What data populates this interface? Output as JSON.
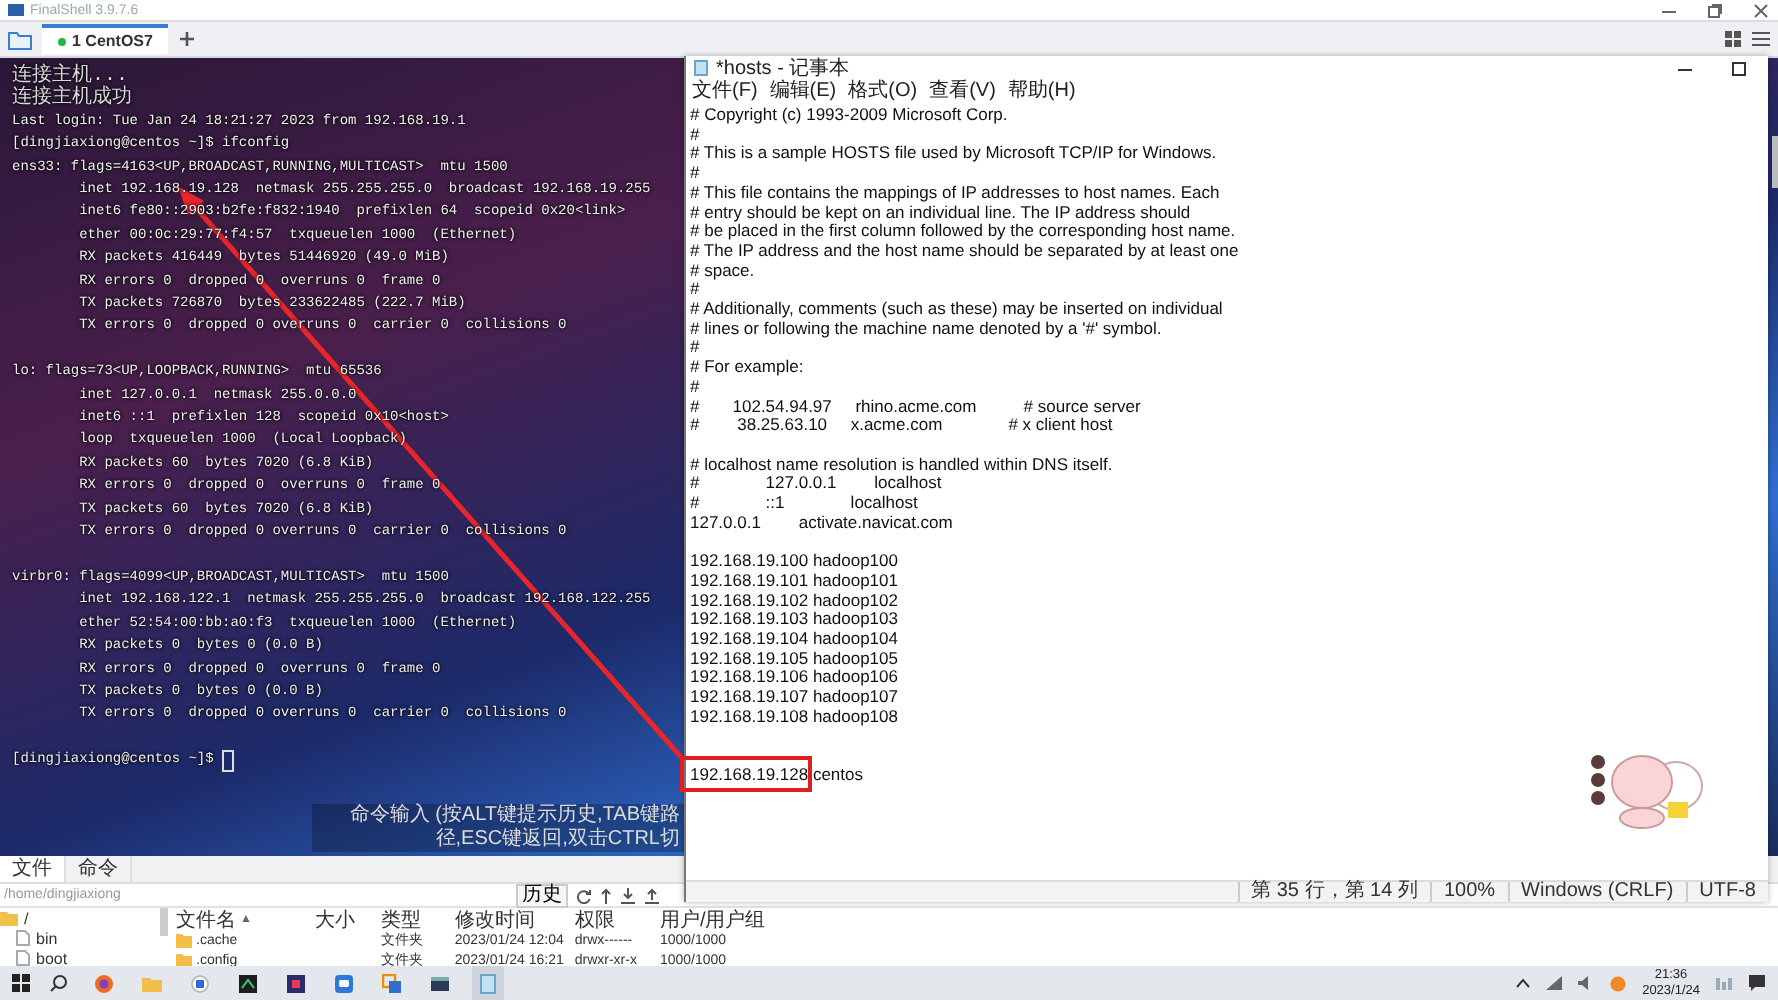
{
  "finalshell": {
    "title": "FinalShell 3.9.7.6",
    "tabs": [
      {
        "label": "1 CentOS7",
        "selected": true
      }
    ]
  },
  "terminal": {
    "messages": [
      "连接主机...",
      "连接主机成功"
    ],
    "blocks": [
      [
        "Last login: Tue Jan 24 18:21:27 2023 from 192.168.19.1",
        "[dingjiaxiong@centos ~]$ ifconfig",
        "ens33: flags=4163<UP,BROADCAST,RUNNING,MULTICAST>  mtu 1500",
        "        inet 192.168.19.128  netmask 255.255.255.0  broadcast 192.168.19.255",
        "        inet6 fe80::2903:b2fe:f832:1940  prefixlen 64  scopeid 0x20<link>",
        "        ether 00:0c:29:77:f4:57  txqueuelen 1000  (Ethernet)",
        "        RX packets 416449  bytes 51446920 (49.0 MiB)",
        "        RX errors 0  dropped 0  overruns 0  frame 0",
        "        TX packets 726870  bytes 233622485 (222.7 MiB)",
        "        TX errors 0  dropped 0 overruns 0  carrier 0  collisions 0"
      ],
      [
        "lo: flags=73<UP,LOOPBACK,RUNNING>  mtu 65536",
        "        inet 127.0.0.1  netmask 255.0.0.0",
        "        inet6 ::1  prefixlen 128  scopeid 0x10<host>",
        "        loop  txqueuelen 1000  (Local Loopback)",
        "        RX packets 60  bytes 7020 (6.8 KiB)",
        "        RX errors 0  dropped 0  overruns 0  frame 0",
        "        TX packets 60  bytes 7020 (6.8 KiB)",
        "        TX errors 0  dropped 0 overruns 0  carrier 0  collisions 0"
      ],
      [
        "virbr0: flags=4099<UP,BROADCAST,MULTICAST>  mtu 1500",
        "        inet 192.168.122.1  netmask 255.255.255.0  broadcast 192.168.122.255",
        "        ether 52:54:00:bb:a0:f3  txqueuelen 1000  (Ethernet)",
        "        RX packets 0  bytes 0 (0.0 B)",
        "        RX errors 0  dropped 0  overruns 0  frame 0",
        "        TX packets 0  bytes 0 (0.0 B)",
        "        TX errors 0  dropped 0 overruns 0  carrier 0  collisions 0"
      ]
    ],
    "prompt": "[dingjiaxiong@centos ~]$",
    "hint": "命令输入 (按ALT键提示历史,TAB键路径,ESC键返回,双击CTRL切"
  },
  "file_panel": {
    "tabs": [
      {
        "label": "文件",
        "selected": true
      },
      {
        "label": "命令",
        "selected": false
      }
    ],
    "path": "/home/dingjiaxiong",
    "history_button": "历史",
    "tree": [
      {
        "label": "/",
        "kind": "folder",
        "children": [
          {
            "label": "bin",
            "kind": "link"
          },
          {
            "label": "boot",
            "kind": "link"
          }
        ]
      }
    ],
    "table": {
      "columns": [
        {
          "label": "文件名",
          "sort_indicator": "▲"
        },
        {
          "label": "大小"
        },
        {
          "label": "类型"
        },
        {
          "label": "修改时间"
        },
        {
          "label": "权限"
        },
        {
          "label": "用户/用户组"
        }
      ],
      "rows": [
        {
          "name": ".cache",
          "type": "文件夹",
          "modified": "2023/01/24 12:04",
          "permissions": "drwx------",
          "owner": "1000/1000"
        },
        {
          "name": ".config",
          "type": "文件夹",
          "modified": "2023/01/24 16:21",
          "permissions": "drwxr-xr-x",
          "owner": "1000/1000"
        }
      ]
    }
  },
  "notepad": {
    "title": "*hosts - 记事本",
    "menu": [
      "文件(F)",
      "编辑(E)",
      "格式(O)",
      "查看(V)",
      "帮助(H)"
    ],
    "text": "# Copyright (c) 1993-2009 Microsoft Corp.\n#\n# This is a sample HOSTS file used by Microsoft TCP/IP for Windows.\n#\n# This file contains the mappings of IP addresses to host names. Each\n# entry should be kept on an individual line. The IP address should\n# be placed in the first column followed by the corresponding host name.\n# The IP address and the host name should be separated by at least one\n# space.\n#\n# Additionally, comments (such as these) may be inserted on individual\n# lines or following the machine name denoted by a '#' symbol.\n#\n# For example:\n#\n#       102.54.94.97     rhino.acme.com          # source server\n#        38.25.63.10     x.acme.com              # x client host\n\n# localhost name resolution is handled within DNS itself.\n#              127.0.0.1        localhost\n#              ::1              localhost\n127.0.0.1        activate.navicat.com\n\n192.168.19.100 hadoop100\n192.168.19.101 hadoop101\n192.168.19.102 hadoop102\n192.168.19.103 hadoop103\n192.168.19.104 hadoop104\n192.168.19.105 hadoop105\n192.168.19.106 hadoop106\n192.168.19.107 hadoop107\n192.168.19.108 hadoop108\n\n\n192.168.19.128 centos",
    "status": [
      "第 35 行，第 14 列",
      "100%",
      "Windows (CRLF)",
      "UTF-8"
    ]
  },
  "taskbar": {
    "time": "21:36",
    "date": "2023/1/24"
  }
}
